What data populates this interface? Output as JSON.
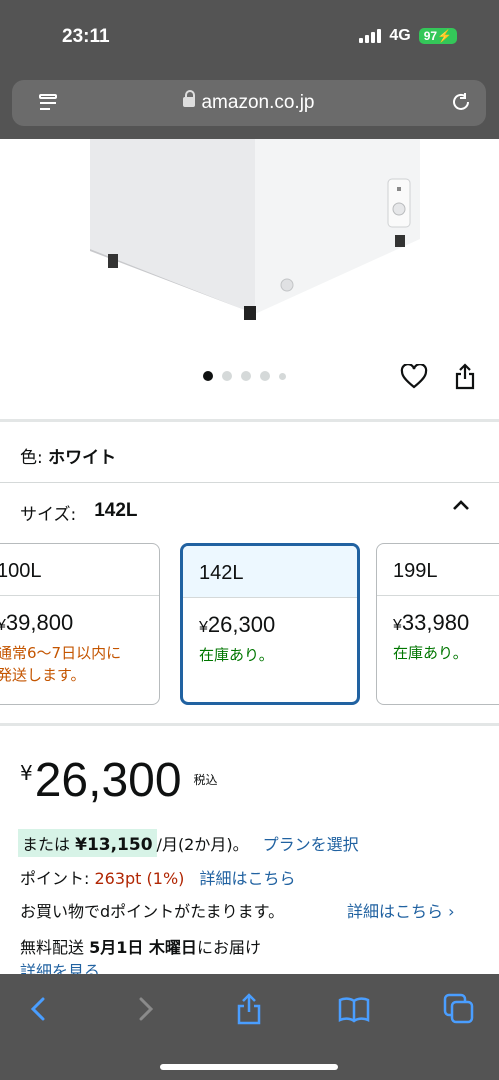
{
  "status_bar": {
    "time": "23:11",
    "network": "4G",
    "battery": "97"
  },
  "browser": {
    "url": "amazon.co.jp",
    "reader_icon": "reader-icon",
    "reload_icon": "reload-icon"
  },
  "image_carousel": {
    "total": 5,
    "active": 1
  },
  "actions": {
    "favorite_icon": "heart-icon",
    "share_icon": "share-icon"
  },
  "variation": {
    "color_label": "色: ",
    "color_value": "ホワイト",
    "size_label": "サイズ:",
    "size_value": "142L"
  },
  "size_options": [
    {
      "size": "100L",
      "price": "39,800",
      "currency": "¥",
      "availability_line1": "通常6～7日以内に",
      "availability_line2": "発送します。",
      "status": "orange"
    },
    {
      "size": "142L",
      "price": "26,300",
      "currency": "¥",
      "availability_line1": "在庫あり。",
      "availability_line2": "",
      "status": "green",
      "selected": true
    },
    {
      "size": "199L",
      "price": "33,980",
      "currency": "¥",
      "availability_line1": "在庫あり。",
      "availability_line2": "",
      "status": "green"
    }
  ],
  "price": {
    "currency": "¥",
    "value": "26,300",
    "tax_note": "税込"
  },
  "installment": {
    "prefix": "または",
    "amount": "¥13,150",
    "suffix": " /月(2か月)。",
    "link": "プランを選択"
  },
  "points": {
    "label": "ポイント: ",
    "value": "263pt  (1%)",
    "link": "詳細はこちら"
  },
  "dpoint": {
    "text": "お買い物でdポイントがたまります。",
    "link": "詳細はこちら ›"
  },
  "delivery": {
    "label": "無料配送  ",
    "date": "5月1日 木曜日",
    "suffix": "にお届け",
    "details_link": "詳細を見る"
  },
  "toolbar": {
    "back": "back-icon",
    "forward": "forward-icon",
    "share": "share-icon",
    "bookmarks": "book-icon",
    "tabs": "tabs-icon"
  },
  "colors": {
    "link": "#2162a1",
    "price_red": "#b12704",
    "in_stock": "#007600",
    "shipping_orange": "#c45500",
    "selected_border": "#2162a1",
    "chrome": "#545454"
  }
}
